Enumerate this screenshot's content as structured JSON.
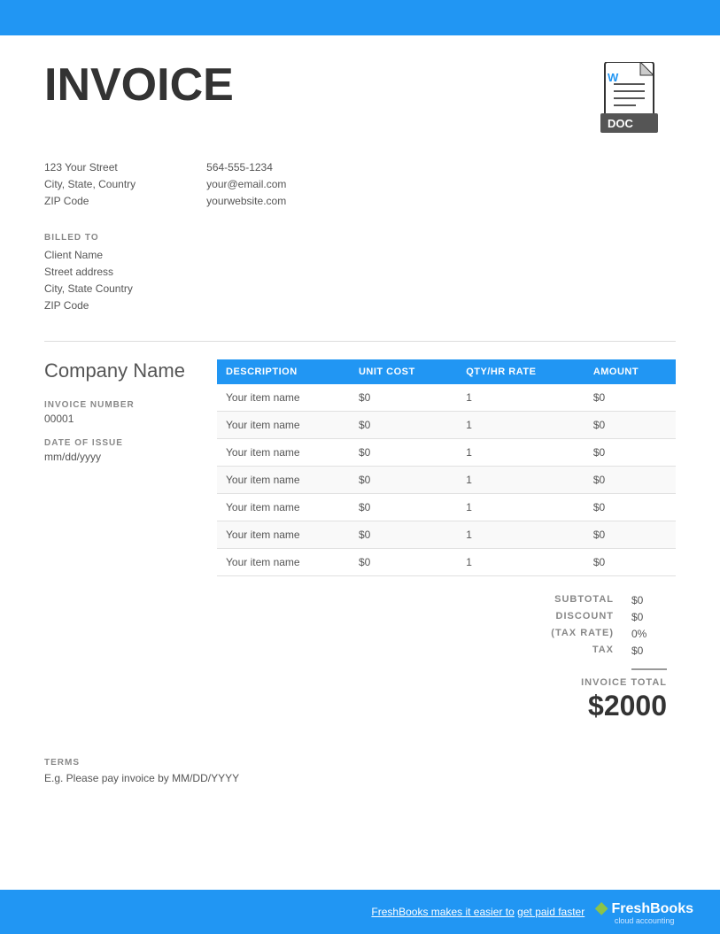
{
  "topBar": {
    "color": "#2196F3"
  },
  "header": {
    "invoice_title": "INVOICE",
    "doc_icon_label": "DOC"
  },
  "address": {
    "street": "123 Your Street",
    "city_state_country": "City, State, Country",
    "zip": "ZIP Code",
    "phone": "564-555-1234",
    "email": "your@email.com",
    "website": "yourwebsite.com"
  },
  "billed_to": {
    "label": "BILLED TO",
    "client_name": "Client Name",
    "street": "Street address",
    "city_state_country": "City, State Country",
    "zip": "ZIP Code"
  },
  "company": {
    "name": "Company Name"
  },
  "invoice_meta": {
    "invoice_number_label": "INVOICE NUMBER",
    "invoice_number": "00001",
    "date_of_issue_label": "DATE OF ISSUE",
    "date_of_issue": "mm/dd/yyyy"
  },
  "table": {
    "headers": [
      "DESCRIPTION",
      "UNIT COST",
      "QTY/HR RATE",
      "AMOUNT"
    ],
    "rows": [
      {
        "description": "Your item name",
        "unit_cost": "$0",
        "qty": "1",
        "amount": "$0"
      },
      {
        "description": "Your item name",
        "unit_cost": "$0",
        "qty": "1",
        "amount": "$0"
      },
      {
        "description": "Your item name",
        "unit_cost": "$0",
        "qty": "1",
        "amount": "$0"
      },
      {
        "description": "Your item name",
        "unit_cost": "$0",
        "qty": "1",
        "amount": "$0"
      },
      {
        "description": "Your item name",
        "unit_cost": "$0",
        "qty": "1",
        "amount": "$0"
      },
      {
        "description": "Your item name",
        "unit_cost": "$0",
        "qty": "1",
        "amount": "$0"
      },
      {
        "description": "Your item name",
        "unit_cost": "$0",
        "qty": "1",
        "amount": "$0"
      }
    ]
  },
  "totals": {
    "subtotal_label": "SUBTOTAL",
    "subtotal_value": "$0",
    "discount_label": "DISCOUNT",
    "discount_value": "$0",
    "tax_rate_label": "(TAX RATE)",
    "tax_rate_value": "0%",
    "tax_label": "TAX",
    "tax_value": "$0",
    "invoice_total_label": "INVOICE TOTAL",
    "invoice_total_value": "$2000"
  },
  "terms": {
    "label": "TERMS",
    "text": "E.g. Please pay invoice by MM/DD/YYYY"
  },
  "footer": {
    "promo_text": "FreshBooks makes it easier to",
    "promo_link": "get paid faster",
    "brand_name": "FreshBooks",
    "brand_sub": "cloud accounting"
  }
}
